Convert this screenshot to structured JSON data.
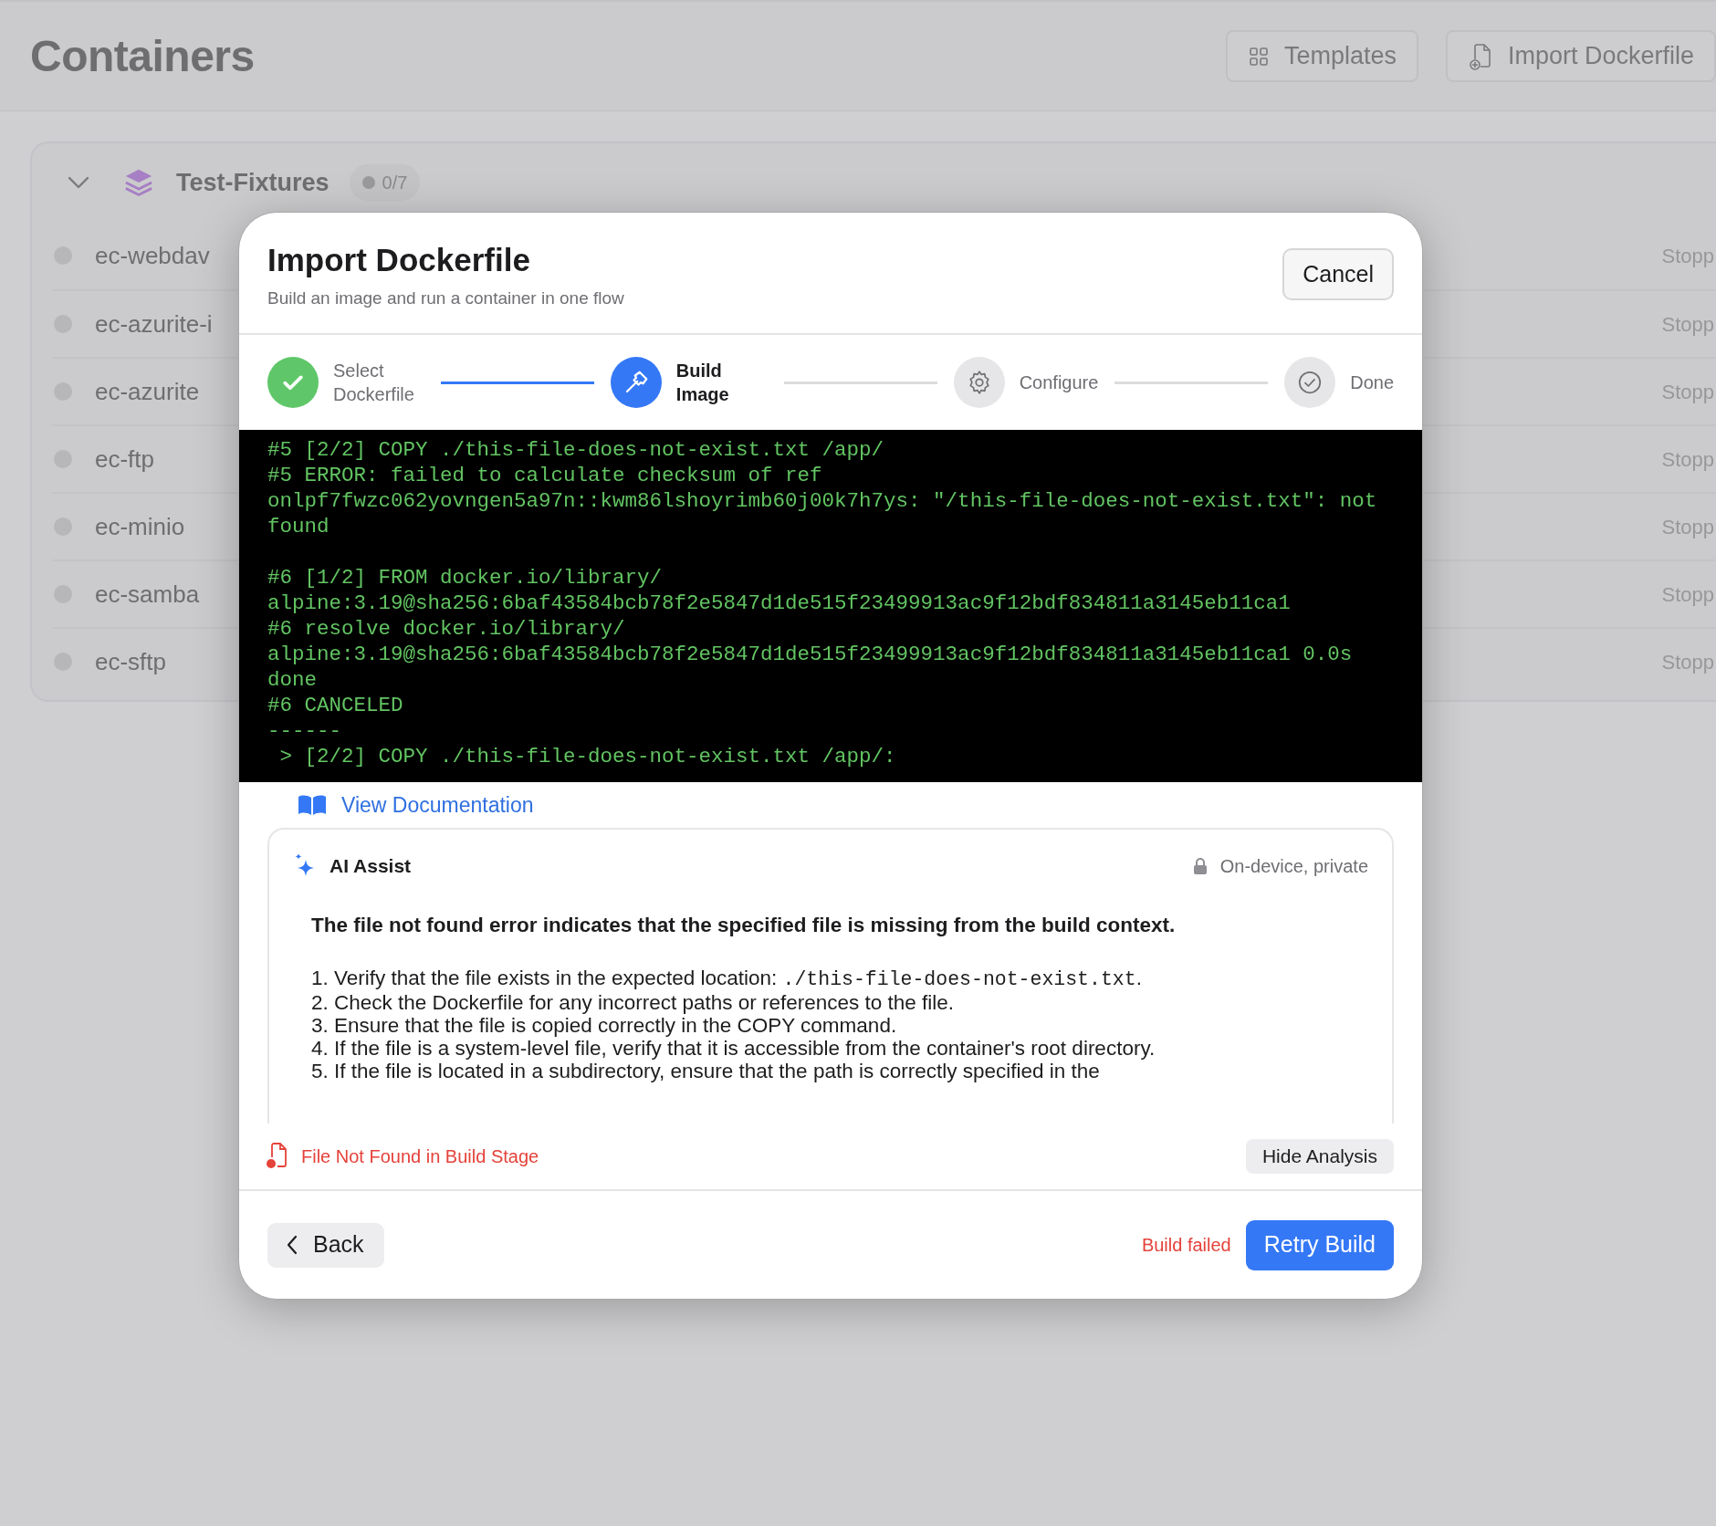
{
  "page": {
    "title": "Containers",
    "actions": [
      {
        "label": "Templates"
      },
      {
        "label": "Import Dockerfile"
      }
    ]
  },
  "group": {
    "name": "Test-Fixtures",
    "count": "0/7",
    "expanded": true,
    "containers": [
      {
        "name": "ec-webdav",
        "status": "Stopp"
      },
      {
        "name": "ec-azurite-i",
        "status": "Stopp"
      },
      {
        "name": "ec-azurite",
        "status": "Stopp"
      },
      {
        "name": "ec-ftp",
        "status": "Stopp"
      },
      {
        "name": "ec-minio",
        "status": "Stopp"
      },
      {
        "name": "ec-samba",
        "status": "Stopp"
      },
      {
        "name": "ec-sftp",
        "status": "Stopp"
      }
    ]
  },
  "dialog": {
    "title": "Import Dockerfile",
    "subtitle": "Build an image and run a container in one flow",
    "cancel": "Cancel",
    "steps": [
      {
        "label": "Select Dockerfile",
        "done": true,
        "selected": false
      },
      {
        "label": "Build Image",
        "done": false,
        "selected": true
      },
      {
        "label": "Configure",
        "done": false,
        "selected": false
      },
      {
        "label": "Done",
        "done": false,
        "selected": false
      }
    ],
    "log_blocks": [
      [
        "#5 [2/2] COPY ./this-file-does-not-exist.txt /app/",
        "#5 ERROR: failed to calculate checksum of ref",
        "onlpf7fwzc062yovngen5a97n::kwm86lshoyrimb60j00k7h7ys: \"/this-file-does-not-exist.txt\": not",
        "found"
      ],
      [
        "#6 [1/2] FROM docker.io/library/",
        "alpine:3.19@sha256:6baf43584bcb78f2e5847d1de515f23499913ac9f12bdf834811a3145eb11ca1",
        "#6 resolve docker.io/library/",
        "alpine:3.19@sha256:6baf43584bcb78f2e5847d1de515f23499913ac9f12bdf834811a3145eb11ca1 0.0s",
        "done",
        "#6 CANCELED",
        "------",
        " > [2/2] COPY ./this-file-does-not-exist.txt /app/:"
      ]
    ],
    "docs_link": "View Documentation",
    "ai": {
      "title": "AI Assist",
      "privacy": "On-device, private",
      "summary": "The file not found error indicates that the specified file is missing from the build context.",
      "items": [
        {
          "text": "1. Verify that the file exists in the expected location: ",
          "code": "./this-file-does-not-exist.txt",
          "after": "."
        },
        {
          "text": "2. Check the Dockerfile for any incorrect paths or references to the file."
        },
        {
          "text": "3. Ensure that the file is copied correctly in the COPY command."
        },
        {
          "text": "4. If the file is a system-level file, verify that it is accessible from the container's root directory."
        },
        {
          "text": "5. If the file is located in a subdirectory, ensure that the path is correctly specified in the"
        }
      ]
    },
    "error": "File Not Found in Build Stage",
    "hide_analysis": "Hide Analysis",
    "back": "Back",
    "status": "Build failed",
    "retry": "Retry Build"
  }
}
